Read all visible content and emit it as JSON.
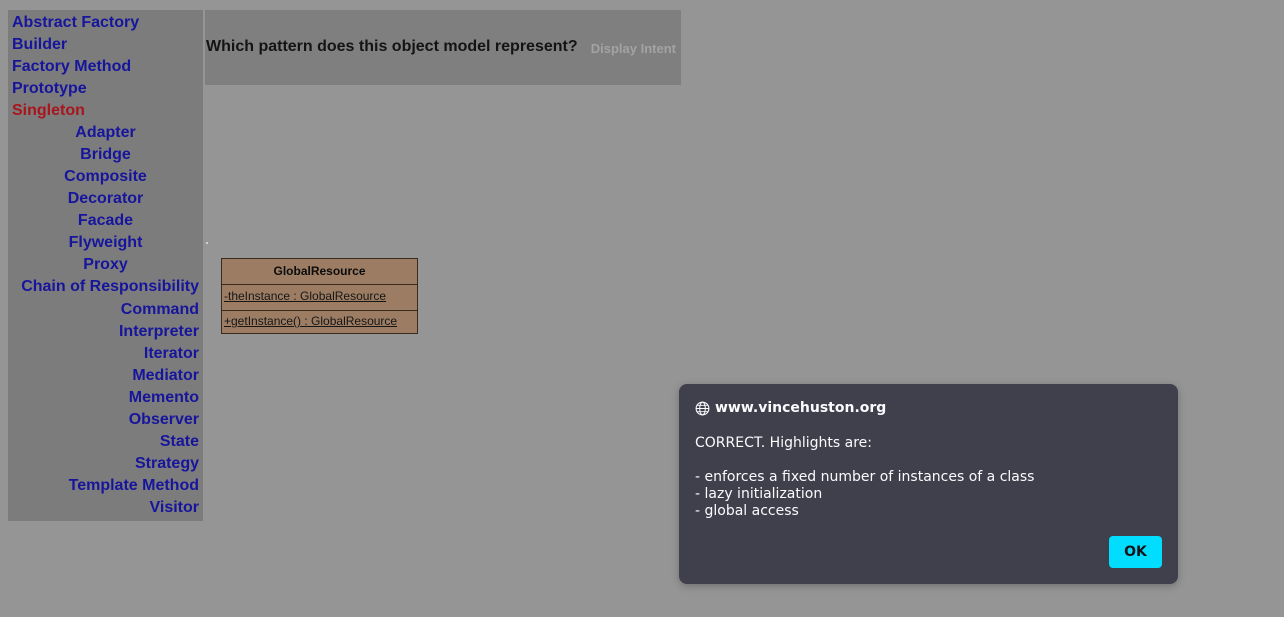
{
  "sidebar": {
    "links": [
      {
        "label": "Abstract Factory"
      },
      {
        "label": "Builder"
      },
      {
        "label": "Factory Method"
      },
      {
        "label": "Prototype"
      },
      {
        "label": "Singleton"
      },
      {
        "label": "Adapter"
      },
      {
        "label": "Bridge"
      },
      {
        "label": "Composite"
      },
      {
        "label": "Decorator"
      },
      {
        "label": "Facade"
      },
      {
        "label": "Flyweight"
      },
      {
        "label": "Proxy"
      },
      {
        "label": "Chain of Responsibility"
      },
      {
        "label": "Command"
      },
      {
        "label": "Interpreter"
      },
      {
        "label": "Iterator"
      },
      {
        "label": "Mediator"
      },
      {
        "label": "Memento"
      },
      {
        "label": "Observer"
      },
      {
        "label": "State"
      },
      {
        "label": "Strategy"
      },
      {
        "label": "Template Method"
      },
      {
        "label": "Visitor"
      }
    ],
    "active": "Singleton",
    "link_color": "#16159c",
    "active_color": "#a8151c"
  },
  "question": {
    "text": "Which pattern does this object model represent?",
    "display_intent": "Display Intent"
  },
  "uml": {
    "class_name": "GlobalResource",
    "attribute": "-theInstance : GlobalResource",
    "operation": "+getInstance() : GlobalResource"
  },
  "dialog": {
    "origin": "www.vincehuston.org",
    "icon": "globe-icon",
    "lines": [
      "CORRECT.  Highlights are:",
      "",
      "- enforces a fixed number of instances of a class",
      "- lazy initialization",
      "- global access"
    ],
    "ok_label": "OK",
    "accent": "#00ddff"
  }
}
